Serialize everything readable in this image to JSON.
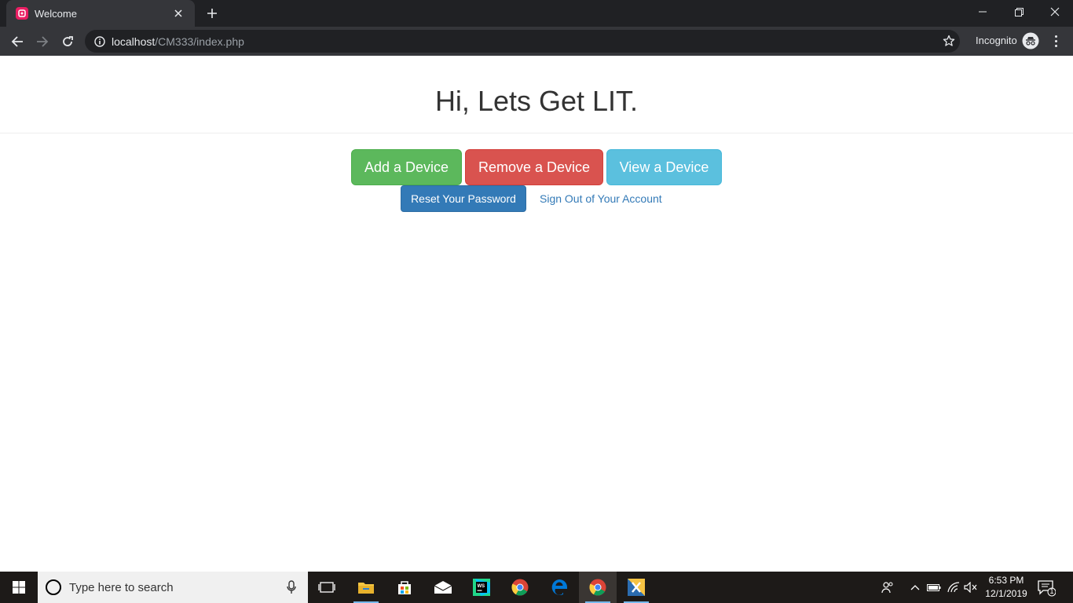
{
  "browser": {
    "tab_title": "Welcome",
    "url_host": "localhost",
    "url_path": "/CM333/index.php",
    "incognito_label": "Incognito"
  },
  "page": {
    "title": "Hi, Lets Get LIT.",
    "buttons": {
      "add": "Add a Device",
      "remove": "Remove a Device",
      "view": "View a Device",
      "reset": "Reset Your Password",
      "signout": "Sign Out of Your Account"
    }
  },
  "taskbar": {
    "search_placeholder": "Type here to search",
    "time": "6:53 PM",
    "date": "12/1/2019",
    "notification_count": "1"
  },
  "colors": {
    "success": "#5cb85c",
    "danger": "#d9534f",
    "info": "#5bc0de",
    "primary": "#337ab7"
  },
  "icons": {
    "favicon": "app-logo-icon",
    "back": "back-arrow-icon",
    "forward": "forward-arrow-icon",
    "reload": "reload-icon",
    "info": "info-icon",
    "star": "star-icon",
    "incognito": "incognito-icon",
    "menu": "kebab-menu-icon"
  }
}
